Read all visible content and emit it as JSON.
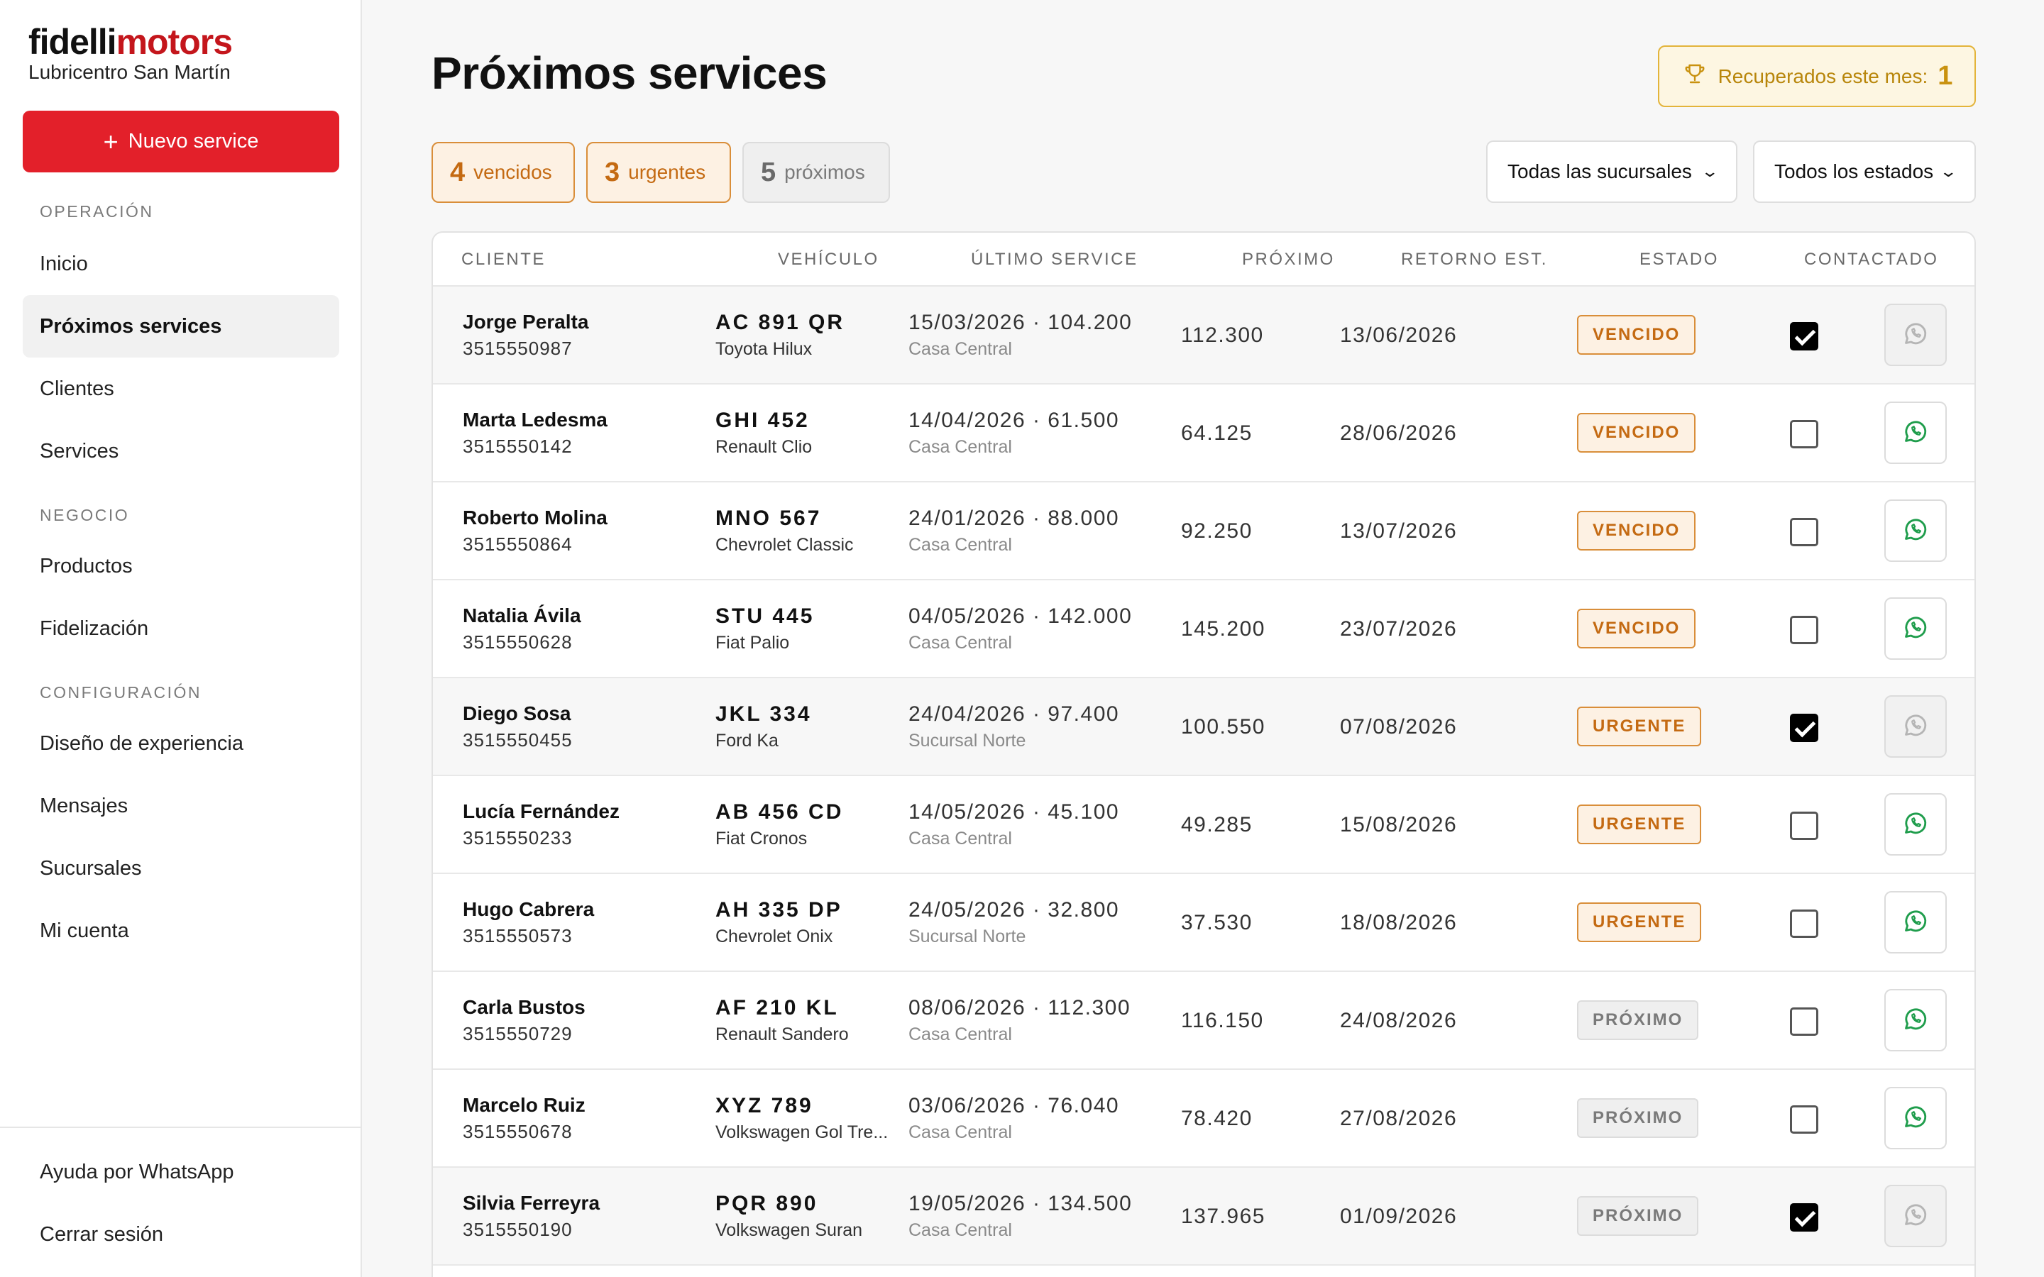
{
  "brand": {
    "name_part1": "fidelli",
    "name_part2": "motors",
    "subtitle": "Lubricentro San Martín"
  },
  "sidebar": {
    "new_button": "Nuevo service",
    "sections": [
      {
        "label": "OPERACIÓN",
        "items": [
          "Inicio",
          "Próximos services",
          "Clientes",
          "Services"
        ]
      },
      {
        "label": "NEGOCIO",
        "items": [
          "Productos",
          "Fidelización"
        ]
      },
      {
        "label": "CONFIGURACIÓN",
        "items": [
          "Diseño de experiencia",
          "Mensajes",
          "Sucursales",
          "Mi cuenta"
        ]
      }
    ],
    "active_item": "Próximos services",
    "footer": [
      "Ayuda por WhatsApp",
      "Cerrar sesión"
    ]
  },
  "header": {
    "title": "Próximos services",
    "recovered_label": "Recuperados este mes:",
    "recovered_count": "1"
  },
  "summary": {
    "vencidos": {
      "count": "4",
      "label": "vencidos"
    },
    "urgentes": {
      "count": "3",
      "label": "urgentes"
    },
    "proximos": {
      "count": "5",
      "label": "próximos"
    }
  },
  "filters": {
    "sucursal": "Todas las sucursales",
    "estado": "Todos los estados"
  },
  "table": {
    "headers": [
      "CLIENTE",
      "VEHÍCULO",
      "ÚLTIMO SERVICE",
      "PRÓXIMO",
      "RETORNO EST.",
      "ESTADO",
      "CONTACTADO"
    ],
    "rows": [
      {
        "name": "Jorge Peralta",
        "phone": "3515550987",
        "plate": "AC 891 QR",
        "model": "Toyota Hilux",
        "last": "15/03/2026 · 104.200",
        "branch": "Casa Central",
        "next": "112.300",
        "return": "13/06/2026",
        "status": "VENCIDO",
        "status_kind": "vencido",
        "contacted": true
      },
      {
        "name": "Marta Ledesma",
        "phone": "3515550142",
        "plate": "GHI 452",
        "model": "Renault Clio",
        "last": "14/04/2026 · 61.500",
        "branch": "Casa Central",
        "next": "64.125",
        "return": "28/06/2026",
        "status": "VENCIDO",
        "status_kind": "vencido",
        "contacted": false
      },
      {
        "name": "Roberto Molina",
        "phone": "3515550864",
        "plate": "MNO 567",
        "model": "Chevrolet Classic",
        "last": "24/01/2026 · 88.000",
        "branch": "Casa Central",
        "next": "92.250",
        "return": "13/07/2026",
        "status": "VENCIDO",
        "status_kind": "vencido",
        "contacted": false
      },
      {
        "name": "Natalia Ávila",
        "phone": "3515550628",
        "plate": "STU 445",
        "model": "Fiat Palio",
        "last": "04/05/2026 · 142.000",
        "branch": "Casa Central",
        "next": "145.200",
        "return": "23/07/2026",
        "status": "VENCIDO",
        "status_kind": "vencido",
        "contacted": false
      },
      {
        "name": "Diego Sosa",
        "phone": "3515550455",
        "plate": "JKL 334",
        "model": "Ford Ka",
        "last": "24/04/2026 · 97.400",
        "branch": "Sucursal Norte",
        "next": "100.550",
        "return": "07/08/2026",
        "status": "URGENTE",
        "status_kind": "urgente",
        "contacted": true
      },
      {
        "name": "Lucía Fernández",
        "phone": "3515550233",
        "plate": "AB 456 CD",
        "model": "Fiat Cronos",
        "last": "14/05/2026 · 45.100",
        "branch": "Casa Central",
        "next": "49.285",
        "return": "15/08/2026",
        "status": "URGENTE",
        "status_kind": "urgente",
        "contacted": false
      },
      {
        "name": "Hugo Cabrera",
        "phone": "3515550573",
        "plate": "AH 335 DP",
        "model": "Chevrolet Onix",
        "last": "24/05/2026 · 32.800",
        "branch": "Sucursal Norte",
        "next": "37.530",
        "return": "18/08/2026",
        "status": "URGENTE",
        "status_kind": "urgente",
        "contacted": false
      },
      {
        "name": "Carla Bustos",
        "phone": "3515550729",
        "plate": "AF 210 KL",
        "model": "Renault Sandero",
        "last": "08/06/2026 · 112.300",
        "branch": "Casa Central",
        "next": "116.150",
        "return": "24/08/2026",
        "status": "PRÓXIMO",
        "status_kind": "proximo",
        "contacted": false
      },
      {
        "name": "Marcelo Ruiz",
        "phone": "3515550678",
        "plate": "XYZ 789",
        "model": "Volkswagen Gol Tre...",
        "last": "03/06/2026 · 76.040",
        "branch": "Casa Central",
        "next": "78.420",
        "return": "27/08/2026",
        "status": "PRÓXIMO",
        "status_kind": "proximo",
        "contacted": false
      },
      {
        "name": "Silvia Ferreyra",
        "phone": "3515550190",
        "plate": "PQR 890",
        "model": "Volkswagen Suran",
        "last": "19/05/2026 · 134.500",
        "branch": "Casa Central",
        "next": "137.965",
        "return": "01/09/2026",
        "status": "PRÓXIMO",
        "status_kind": "proximo",
        "contacted": true
      }
    ]
  },
  "colors": {
    "accent": "#e3202a",
    "brand_red": "#c4161c",
    "whatsapp_green": "#1f9d4c",
    "warning": "#c46a12"
  }
}
